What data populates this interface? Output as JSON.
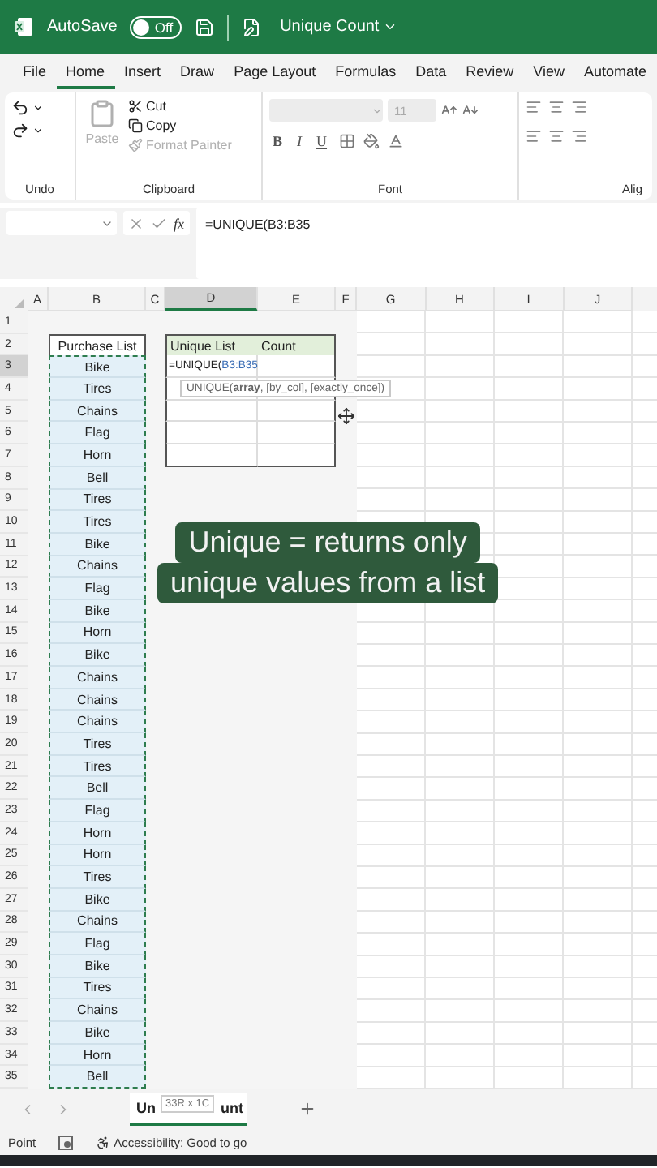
{
  "title_bar": {
    "autosave_label": "AutoSave",
    "autosave_toggle": {
      "label": "Off",
      "on": false
    },
    "document_title": "Unique Count"
  },
  "menu_tabs": [
    {
      "label": "File",
      "selected": false
    },
    {
      "label": "Home",
      "selected": true
    },
    {
      "label": "Insert",
      "selected": false
    },
    {
      "label": "Draw",
      "selected": false
    },
    {
      "label": "Page Layout",
      "selected": false
    },
    {
      "label": "Formulas",
      "selected": false
    },
    {
      "label": "Data",
      "selected": false
    },
    {
      "label": "Review",
      "selected": false
    },
    {
      "label": "View",
      "selected": false
    },
    {
      "label": "Automate",
      "selected": false
    }
  ],
  "ribbon": {
    "undo_group": {
      "label": "Undo"
    },
    "clipboard_group": {
      "label": "Clipboard",
      "paste": {
        "label": "Paste",
        "disabled": true
      },
      "items": [
        {
          "kind": "cut",
          "label": "Cut",
          "disabled": false
        },
        {
          "kind": "copy",
          "label": "Copy",
          "disabled": false
        },
        {
          "kind": "painter",
          "label": "Format Painter",
          "disabled": true
        }
      ]
    },
    "font_group": {
      "label": "Font",
      "font_size": "11",
      "bold": "B",
      "italic": "I",
      "underline": "U"
    },
    "alignment_group": {
      "label": "Alig"
    }
  },
  "formula_bar": {
    "fx_label": "fx",
    "formula": "=UNIQUE(B3:B35"
  },
  "columns": [
    {
      "label": "A",
      "selected": false
    },
    {
      "label": "B",
      "selected": false
    },
    {
      "label": "C",
      "selected": false
    },
    {
      "label": "D",
      "selected": true
    },
    {
      "label": "E",
      "selected": false
    },
    {
      "label": "F",
      "selected": false
    },
    {
      "label": "G",
      "selected": false
    },
    {
      "label": "H",
      "selected": false
    },
    {
      "label": "I",
      "selected": false
    },
    {
      "label": "J",
      "selected": false
    }
  ],
  "rows": [
    {
      "number": "1",
      "selected": false
    },
    {
      "number": "2",
      "selected": false
    },
    {
      "number": "3",
      "selected": true
    },
    {
      "number": "4",
      "selected": false
    },
    {
      "number": "5",
      "selected": false
    },
    {
      "number": "6",
      "selected": false
    },
    {
      "number": "7",
      "selected": false
    },
    {
      "number": "8",
      "selected": false
    },
    {
      "number": "9",
      "selected": false
    },
    {
      "number": "10",
      "selected": false
    },
    {
      "number": "11",
      "selected": false
    },
    {
      "number": "12",
      "selected": false
    },
    {
      "number": "13",
      "selected": false
    },
    {
      "number": "14",
      "selected": false
    },
    {
      "number": "15",
      "selected": false
    },
    {
      "number": "16",
      "selected": false
    },
    {
      "number": "17",
      "selected": false
    },
    {
      "number": "18",
      "selected": false
    },
    {
      "number": "19",
      "selected": false
    },
    {
      "number": "20",
      "selected": false
    },
    {
      "number": "21",
      "selected": false
    },
    {
      "number": "22",
      "selected": false
    },
    {
      "number": "23",
      "selected": false
    },
    {
      "number": "24",
      "selected": false
    },
    {
      "number": "25",
      "selected": false
    },
    {
      "number": "26",
      "selected": false
    },
    {
      "number": "27",
      "selected": false
    },
    {
      "number": "28",
      "selected": false
    },
    {
      "number": "29",
      "selected": false
    },
    {
      "number": "30",
      "selected": false
    },
    {
      "number": "31",
      "selected": false
    },
    {
      "number": "32",
      "selected": false
    },
    {
      "number": "33",
      "selected": false
    },
    {
      "number": "34",
      "selected": false
    },
    {
      "number": "35",
      "selected": false
    }
  ],
  "purchase_header": "Purchase List",
  "purchase_list": [
    "Bike",
    "Tires",
    "Chains",
    "Flag",
    "Horn",
    "Bell",
    "Tires",
    "Tires",
    "Bike",
    "Chains",
    "Flag",
    "Bike",
    "Horn",
    "Bike",
    "Chains",
    "Chains",
    "Chains",
    "Tires",
    "Tires",
    "Bell",
    "Flag",
    "Horn",
    "Horn",
    "Tires",
    "Bike",
    "Chains",
    "Flag",
    "Bike",
    "Tires",
    "Chains",
    "Bike",
    "Horn",
    "Bell"
  ],
  "unique_table": {
    "headers": [
      "Unique List",
      "Count"
    ],
    "editing_cell": {
      "function": "=UNIQUE(",
      "reference": "B3:B35"
    }
  },
  "function_tooltip": "UNIQUE(**array**, [by_col], [exactly_once])",
  "caption": [
    "Unique = returns only",
    "unique values from a list"
  ],
  "sheet_tabs": {
    "tab": {
      "label_start": "Un",
      "label_end": "unt",
      "selected": true
    },
    "range_tooltip": "33R x 1C"
  },
  "status_bar": {
    "mode": "Point",
    "accessibility": "Accessibility: Good to go"
  }
}
